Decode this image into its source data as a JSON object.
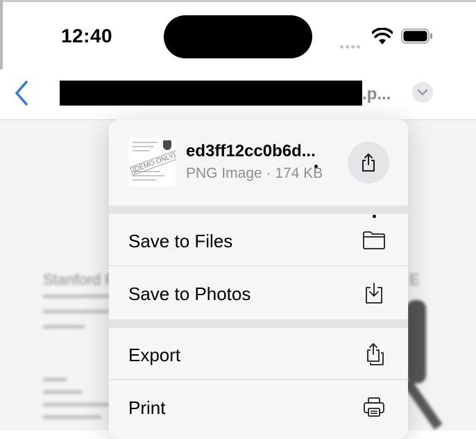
{
  "status_bar": {
    "time": "12:40"
  },
  "nav": {
    "title_tail": ".p..."
  },
  "file": {
    "name": "ed3ff12cc0b6d...",
    "meta": "PNG Image · 174 KB",
    "thumbnail_stamp": "[DEMO ONLY]"
  },
  "menu": {
    "items": [
      {
        "label": "Save to Files",
        "icon": "folder-icon"
      },
      {
        "label": "Save to Photos",
        "icon": "download-tray-icon"
      },
      {
        "label": "Export",
        "icon": "export-icon"
      },
      {
        "label": "Print",
        "icon": "printer-icon"
      }
    ]
  },
  "background_document": {
    "title_start": "Stanford F",
    "title_end": "E"
  },
  "colors": {
    "accent": "#3478f6",
    "menu_bg": "#f6f6f6",
    "gap": "#e4e4e4"
  }
}
